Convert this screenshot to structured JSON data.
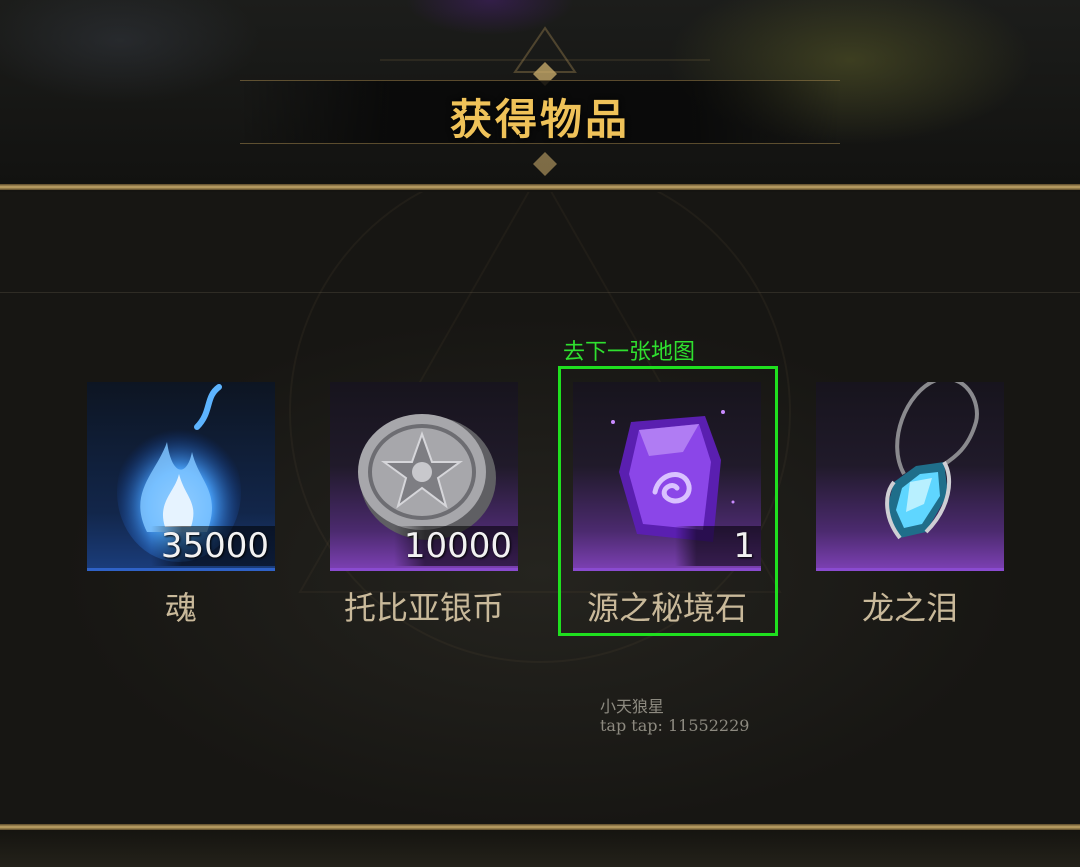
{
  "header": {
    "title": "获得物品"
  },
  "items": [
    {
      "name": "魂",
      "count": "35000",
      "icon": "blue-flame-icon",
      "rarity_color": "#2f62c7"
    },
    {
      "name": "托比亚银币",
      "count": "10000",
      "icon": "silver-coin-icon",
      "rarity_color": "#8a4bd0"
    },
    {
      "name": "源之秘境石",
      "count": "1",
      "icon": "purple-crystal-icon",
      "rarity_color": "#8a4bd0"
    },
    {
      "name": "龙之泪",
      "count": "",
      "icon": "dragon-tear-pendant-icon",
      "rarity_color": "#8a4bd0"
    }
  ],
  "annotation": {
    "text": "去下一张地图",
    "color": "#1fe01f"
  },
  "watermark": {
    "line1": "小天狼星",
    "line2": "tap tap: 11552229"
  },
  "colors": {
    "title": "#efc259",
    "gold_trim": "#c4a769",
    "item_label": "#c9b99a"
  }
}
